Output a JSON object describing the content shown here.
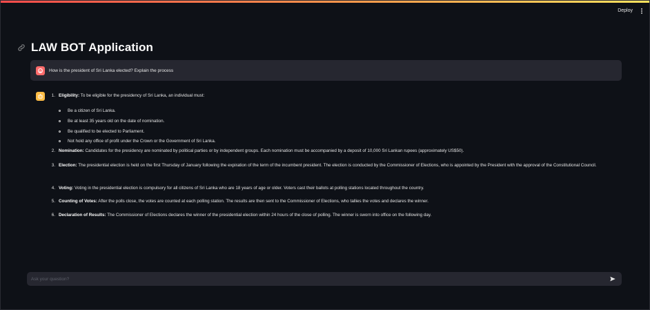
{
  "header": {
    "deploy_label": "Deploy",
    "menu_icon": "kebab-menu-icon"
  },
  "page": {
    "title": "LAW BOT Application",
    "title_icon": "link-icon"
  },
  "chat": {
    "user_message": "How is the president of Sri Lanka elected? Explain the process",
    "assistant": {
      "items": [
        {
          "num": "1.",
          "label": "Eligibility:",
          "text": " To be eligible for the presidency of Sri Lanka, an individual must:",
          "subitems": [
            "Be a citizen of Sri Lanka.",
            "Be at least 35 years old on the date of nomination.",
            "Be qualified to be elected to Parliament.",
            "Not hold any office of profit under the Crown or the Government of Sri Lanka."
          ]
        },
        {
          "num": "2.",
          "label": "Nomination:",
          "text": " Candidates for the presidency are nominated by political parties or by independent groups. Each nomination must be accompanied by a deposit of 10,000 Sri Lankan rupees (approximately US$50)."
        },
        {
          "num": "3.",
          "label": "Election:",
          "text": " The presidential election is held on the first Thursday of January following the expiration of the term of the incumbent president. The election is conducted by the Commissioner of Elections, who is appointed by the President with the approval of the Constitutional Council."
        },
        {
          "num": "4.",
          "label": "Voting:",
          "text": " Voting in the presidential election is compulsory for all citizens of Sri Lanka who are 18 years of age or older. Voters cast their ballots at polling stations located throughout the country."
        },
        {
          "num": "5.",
          "label": "Counting of Votes:",
          "text": " After the polls close, the votes are counted at each polling station. The results are then sent to the Commissioner of Elections, who tallies the votes and declares the winner."
        },
        {
          "num": "6.",
          "label": "Declaration of Results:",
          "text": " The Commissioner of Elections declares the winner of the presidential election within 24 hours of the close of polling. The winner is sworn into office on the following day."
        }
      ]
    },
    "input": {
      "placeholder": "Ask your question?",
      "value": ""
    }
  },
  "colors": {
    "background": "#0e1117",
    "surface": "#262730",
    "user_avatar": "#ff6b6b",
    "bot_avatar": "#ffbd45",
    "accent_start": "#ff4b4b",
    "accent_end": "#ffe45e"
  }
}
